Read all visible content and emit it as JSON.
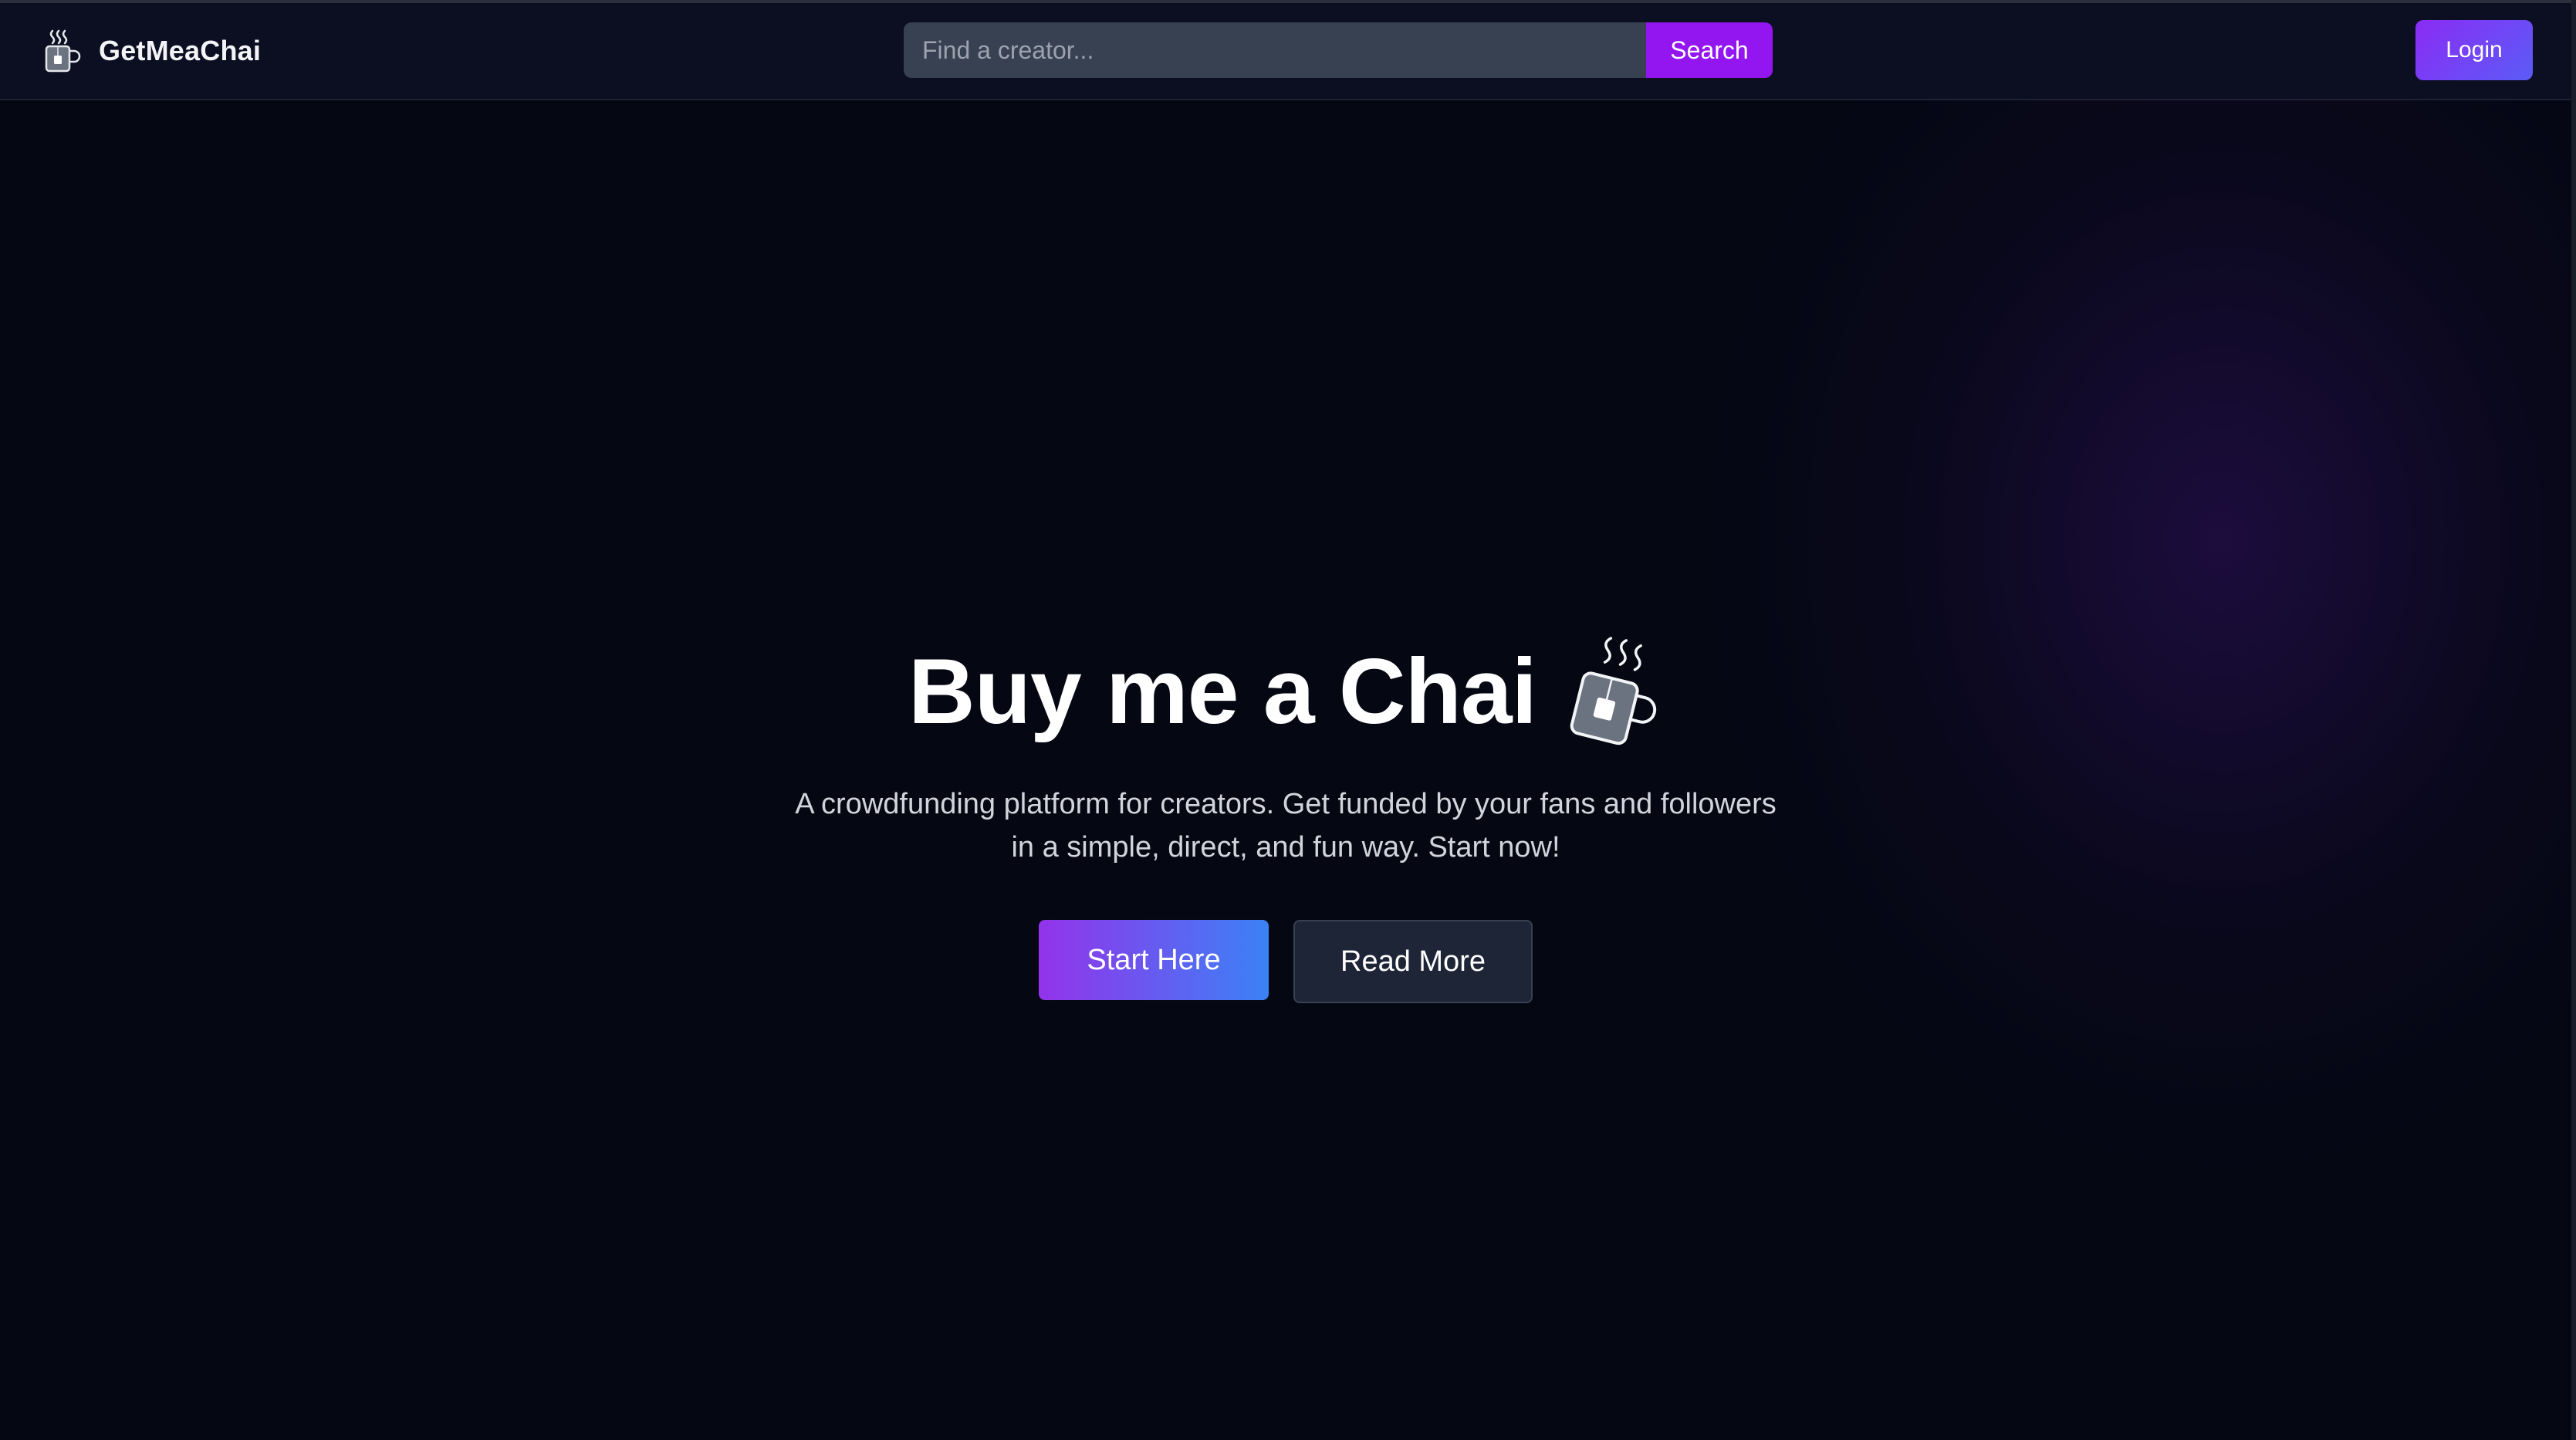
{
  "navbar": {
    "brand_name": "GetMeaChai",
    "brand_icon": "tea-cup-icon",
    "search": {
      "placeholder": "Find a creator...",
      "value": "",
      "button_label": "Search"
    },
    "login_label": "Login"
  },
  "hero": {
    "title": "Buy me a Chai",
    "title_icon": "tea-cup-icon",
    "subtitle_line1": "A crowdfunding platform for creators. Get funded by your fans and followers",
    "subtitle_line2": "in a simple, direct, and fun way. Start now!",
    "primary_button": "Start Here",
    "secondary_button": "Read More"
  },
  "colors": {
    "background": "#050713",
    "navbar": "#0c0f22",
    "search_button": "#9316f0",
    "accent_purple": "#9333ea",
    "accent_blue": "#3b82f6",
    "secondary_button": "#1e2536"
  }
}
